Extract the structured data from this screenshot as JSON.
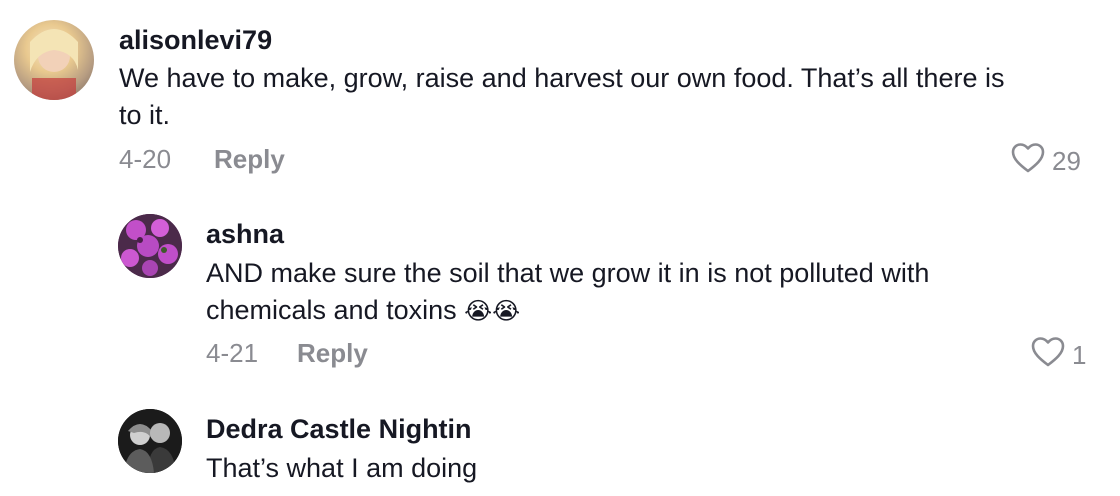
{
  "comments": [
    {
      "username": "alisonlevi79",
      "text_line1": "We have to make, grow, raise and harvest our own food. That’s all there is",
      "text_line2": "to it.",
      "date": "4-20",
      "reply_label": "Reply",
      "likes": "29"
    },
    {
      "username": "ashna",
      "text_line1": "AND make sure the soil that we grow it in is not polluted with",
      "text_line2": "chemicals and toxins",
      "emoji": "😭😭",
      "date": "4-21",
      "reply_label": "Reply",
      "likes": "1"
    },
    {
      "username": "Dedra Castle Nightin",
      "text_line1": "That’s what I am doing"
    }
  ],
  "icons": {
    "like": "heart-outline-icon"
  },
  "colors": {
    "text": "#161823",
    "muted": "#8a8b91"
  }
}
